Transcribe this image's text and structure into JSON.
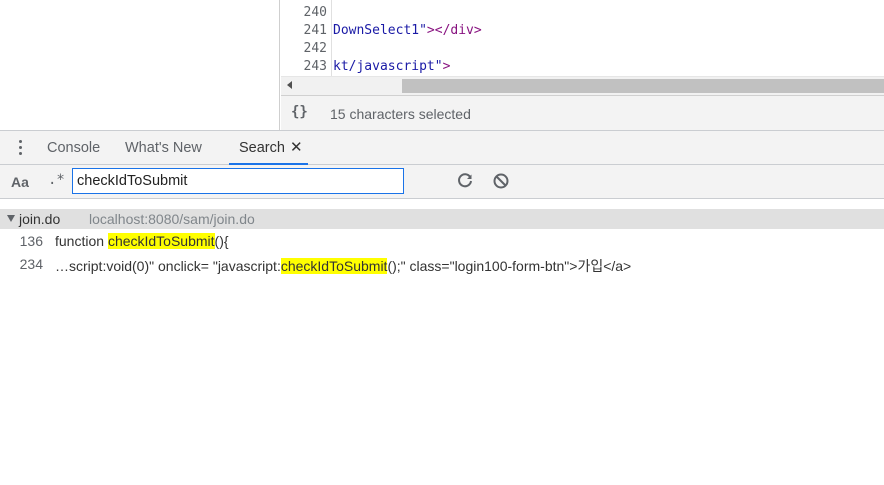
{
  "editor": {
    "lines": [
      {
        "num": "240",
        "segments": []
      },
      {
        "num": "241",
        "segments": [
          {
            "t": "DownSelect1\"",
            "c": "str"
          },
          {
            "t": "></div>",
            "c": "tag"
          }
        ]
      },
      {
        "num": "242",
        "segments": []
      },
      {
        "num": "243",
        "segments": [
          {
            "t": "kt/javascript\"",
            "c": "str"
          },
          {
            "t": ">",
            "c": "tag"
          }
        ]
      }
    ]
  },
  "statusbar": {
    "pretty_print_label": "{}",
    "selection_text": "15 characters selected"
  },
  "drawer": {
    "tabs": [
      {
        "label": "Console"
      },
      {
        "label": "What's New"
      },
      {
        "label": "Search"
      }
    ],
    "close_glyph": "✕"
  },
  "search": {
    "match_case_label": "Aa",
    "regex_label": ".*",
    "query": "checkIdToSubmit",
    "refresh_icon": "refresh-icon",
    "clear_icon": "clear-icon"
  },
  "results": {
    "file": {
      "name": "join.do",
      "path": "localhost:8080/sam/join.do"
    },
    "matches": [
      {
        "line": "136",
        "before": "function ",
        "match": "checkIdToSubmit",
        "after": "(){"
      },
      {
        "line": "234",
        "before": "…script:void(0)\" onclick= \"javascript:",
        "match": "checkIdToSubmit",
        "after": "();\" class=\"login100-form-btn\">가입</a>"
      }
    ]
  },
  "colors": {
    "accent": "#1a73e8",
    "highlight": "#ffff00"
  }
}
